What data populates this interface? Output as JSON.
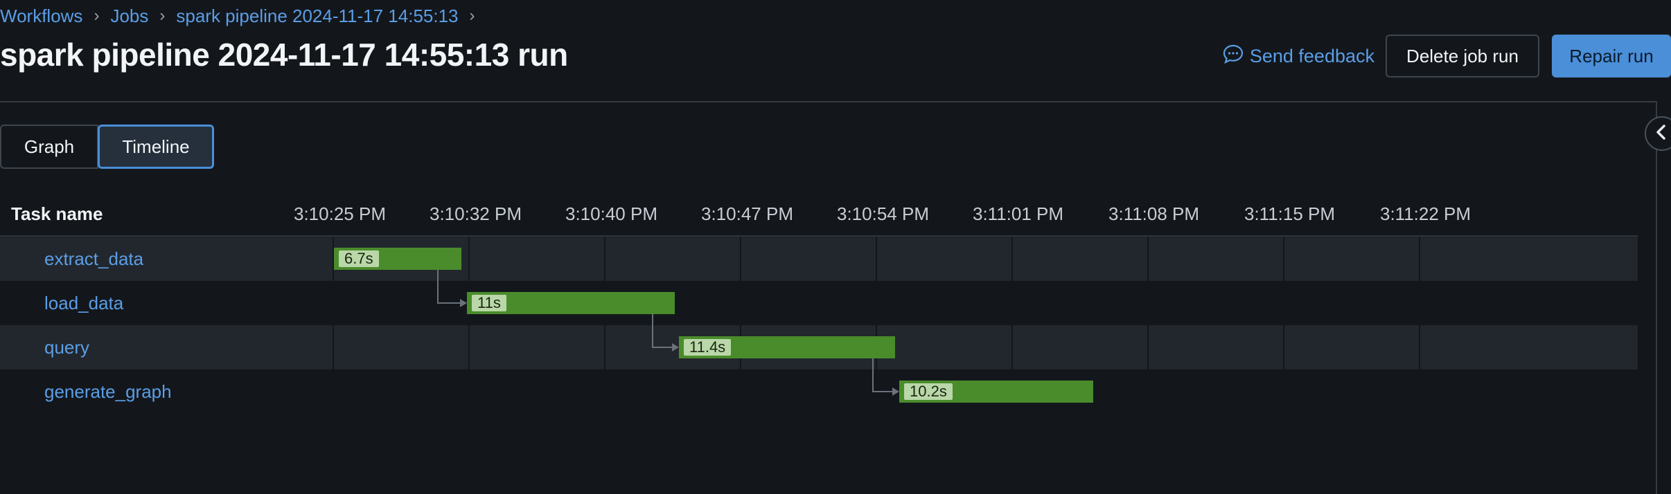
{
  "breadcrumb": {
    "items": [
      {
        "label": "Workflows"
      },
      {
        "label": "Jobs"
      },
      {
        "label": "spark pipeline 2024-11-17 14:55:13"
      }
    ]
  },
  "page_title": "spark pipeline 2024-11-17 14:55:13 run",
  "actions": {
    "feedback_label": "Send feedback",
    "delete_label": "Delete job run",
    "repair_label": "Repair run"
  },
  "view_toggle": {
    "graph_label": "Graph",
    "timeline_label": "Timeline",
    "selected": "Timeline"
  },
  "timeline": {
    "task_name_header": "Task name",
    "ticks": [
      "3:10:25 PM",
      "3:10:32 PM",
      "3:10:40 PM",
      "3:10:47 PM",
      "3:10:54 PM",
      "3:11:01 PM",
      "3:11:08 PM",
      "3:11:15 PM",
      "3:11:22 PM"
    ],
    "tasks": [
      {
        "name": "extract_data",
        "duration_label": "6.7s"
      },
      {
        "name": "load_data",
        "duration_label": "11s"
      },
      {
        "name": "query",
        "duration_label": "11.4s"
      },
      {
        "name": "generate_graph",
        "duration_label": "10.2s"
      }
    ]
  },
  "colors": {
    "background": "#13171c",
    "accent": "#4a8fd8",
    "link": "#5b9ee6",
    "bar_success": "#4a8c2c",
    "bar_label_bg": "#b9d7a8"
  },
  "icons": {
    "feedback": "chat-bubble-icon",
    "collapse": "chevron-left-icon",
    "breadcrumb_separator": "chevron-right-icon"
  }
}
